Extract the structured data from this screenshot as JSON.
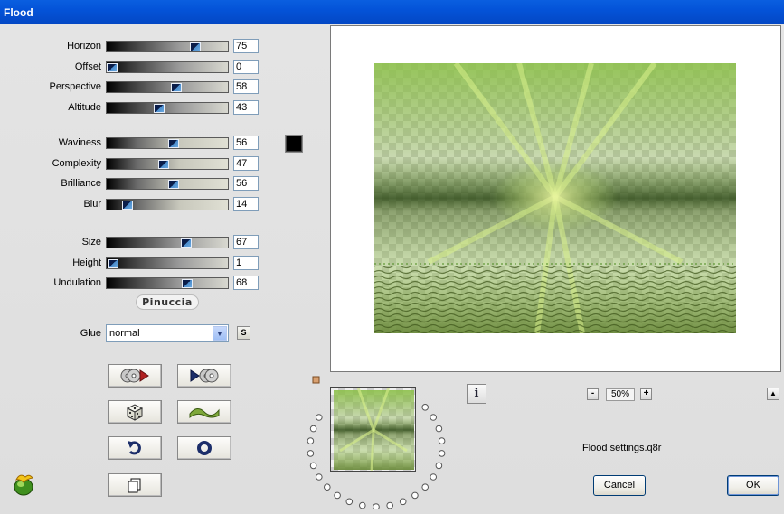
{
  "window": {
    "title": "Flood"
  },
  "sliders_group1": [
    {
      "label": "Horizon",
      "value": "75",
      "pos": 0.75
    },
    {
      "label": "Offset",
      "value": "0",
      "pos": 0.0
    },
    {
      "label": "Perspective",
      "value": "58",
      "pos": 0.58
    },
    {
      "label": "Altitude",
      "value": "43",
      "pos": 0.43
    }
  ],
  "sliders_group2": [
    {
      "label": "Waviness",
      "value": "56",
      "pos": 0.56
    },
    {
      "label": "Complexity",
      "value": "47",
      "pos": 0.47
    },
    {
      "label": "Brilliance",
      "value": "56",
      "pos": 0.56
    },
    {
      "label": "Blur",
      "value": "14",
      "pos": 0.14
    }
  ],
  "sliders_group3": [
    {
      "label": "Size",
      "value": "67",
      "pos": 0.67
    },
    {
      "label": "Height",
      "value": "1",
      "pos": 0.01
    },
    {
      "label": "Undulation",
      "value": "68",
      "pos": 0.68
    }
  ],
  "color": {
    "value": "#000000"
  },
  "logo": {
    "text": "Pinuccia"
  },
  "glue": {
    "label": "Glue",
    "value": "normal",
    "s_label": "S"
  },
  "zoom": {
    "value": "50%",
    "minus": "-",
    "plus": "+"
  },
  "info": {
    "label": "i"
  },
  "settings_file": "Flood settings.q8r",
  "buttons": {
    "cancel": "Cancel",
    "ok": "OK"
  },
  "icons": {
    "open": "disk-arrow-icon",
    "save": "arrow-disk-icon",
    "random": "dice-icon",
    "preset": "wave-icon",
    "undo": "undo-arrow-icon",
    "reset": "ring-icon",
    "copy": "copy-icon",
    "app": "flaming-pear-icon"
  }
}
